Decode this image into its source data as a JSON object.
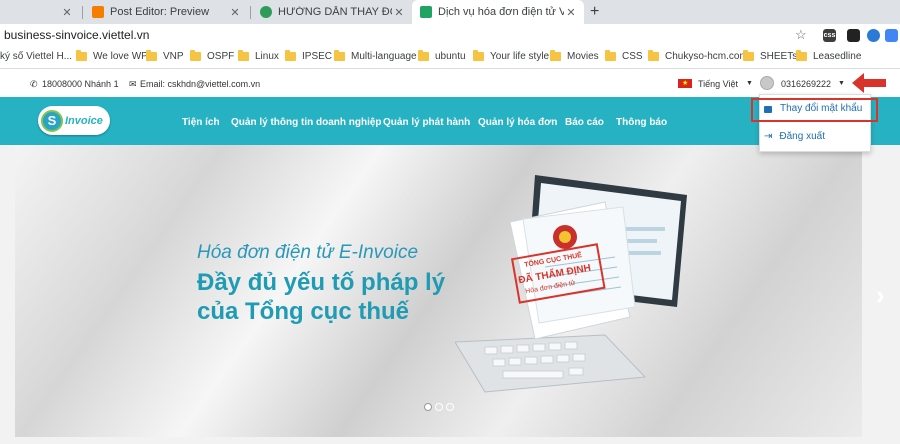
{
  "browser": {
    "tabs": [
      {
        "title": "",
        "close": "✕"
      },
      {
        "title": "Post Editor: Preview",
        "close": "✕"
      },
      {
        "title": "HƯỚNG DẪN THAY ĐỔI MẬT KH",
        "close": "✕"
      },
      {
        "title": "Dịch vụ hóa đơn điện tử Viettel",
        "close": "✕"
      }
    ],
    "new_tab": "+",
    "url": "business-sinvoice.viettel.vn",
    "bookmarks": [
      "ký số Viettel H...",
      "We love WP",
      "VNP",
      "OSPF",
      "Linux",
      "IPSEC",
      "Multi-language",
      "ubuntu",
      "Your life style",
      "Movies",
      "CSS",
      "Chukyso-hcm.com",
      "SHEETs",
      "Leasedline"
    ]
  },
  "site": {
    "hotline": "18008000 Nhánh 1",
    "email": "Email: cskhdn@viettel.com.vn",
    "language": "Tiếng Việt",
    "account": "0316269222",
    "logo_text": "Invoice",
    "logo_letter": "S",
    "nav": [
      "Tiện ích",
      "Quản lý thông tin doanh nghiệp",
      "Quản lý phát hành",
      "Quản lý hóa đơn",
      "Báo cáo",
      "Thông báo"
    ],
    "dropdown": {
      "change_password": "Thay đổi mật khẩu",
      "logout": "Đăng xuất"
    },
    "hero": {
      "line1": "Hóa đơn điện tử E-Invoice",
      "line2": "Đầy đủ yếu tố pháp lý",
      "line3": "của Tổng cục thuế",
      "stamp_line1": "TỔNG CỤC THUẾ",
      "stamp_line2": "ĐÃ THẨM ĐỊNH",
      "stamp_line3": "Hóa đơn điện tử"
    },
    "slider_dots": 3,
    "slider_active": 1
  },
  "colors": {
    "nav_bg": "#27b2c4",
    "highlight_box": "#d9342b",
    "link": "#1e6fb5"
  }
}
